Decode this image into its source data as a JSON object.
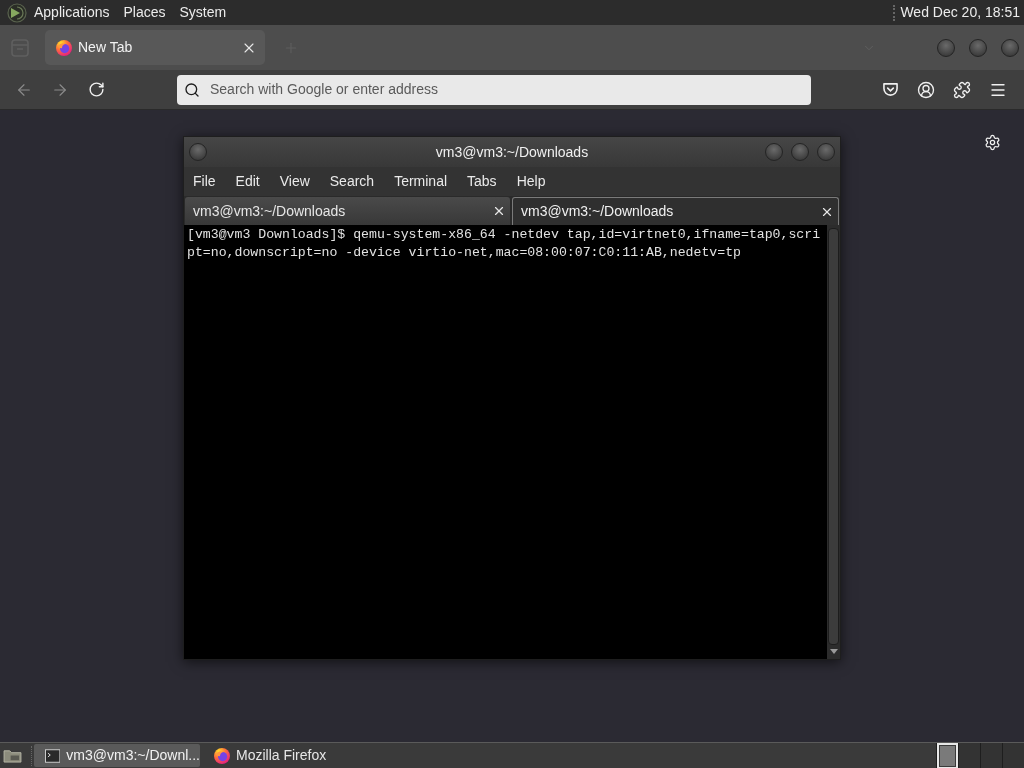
{
  "top_panel": {
    "menus": [
      "Applications",
      "Places",
      "System"
    ],
    "clock": "Wed Dec 20, 18:51"
  },
  "browser": {
    "tabs": [
      {
        "title": "New Tab",
        "selected": true
      }
    ],
    "address_bar": {
      "placeholder": "Search with Google or enter address"
    }
  },
  "terminal": {
    "title": "vm3@vm3:~/Downloads",
    "menu": [
      "File",
      "Edit",
      "View",
      "Search",
      "Terminal",
      "Tabs",
      "Help"
    ],
    "tabs": [
      {
        "title": "vm3@vm3:~/Downloads",
        "selected": false
      },
      {
        "title": "vm3@vm3:~/Downloads",
        "selected": true
      }
    ],
    "lines": [
      "[vm3@vm3 Downloads]$ qemu-system-x86_64 -netdev tap,id=virtnet0,ifname=tap0,scri",
      "pt=no,downscript=no -device virtio-net,mac=08:00:07:C0:11:AB,nedetv=tp"
    ]
  },
  "taskbar": {
    "tasks": [
      {
        "kind": "terminal",
        "title": "vm3@vm3:~/Downl...",
        "selected": true
      },
      {
        "kind": "browser",
        "title": "Mozilla Firefox",
        "selected": false
      }
    ],
    "workspaces": [
      {
        "selected": true
      },
      {
        "selected": false
      },
      {
        "selected": false
      },
      {
        "selected": false
      }
    ]
  }
}
